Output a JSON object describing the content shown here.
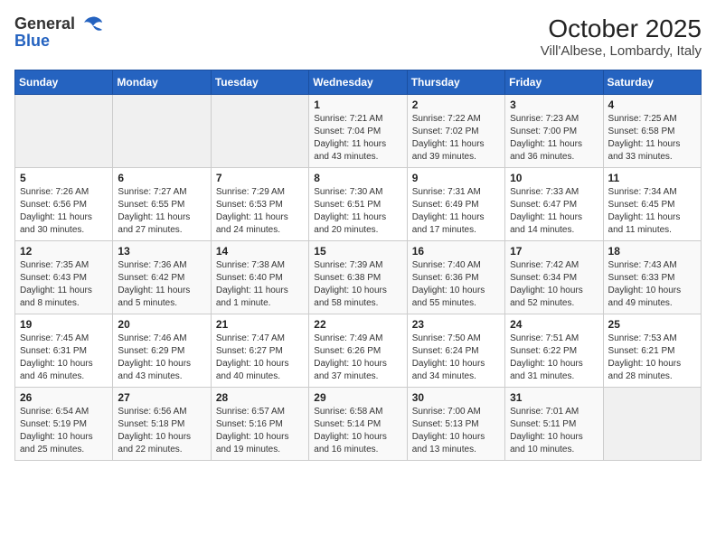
{
  "header": {
    "logo_general": "General",
    "logo_blue": "Blue",
    "month_title": "October 2025",
    "location": "Vill'Albese, Lombardy, Italy"
  },
  "weekdays": [
    "Sunday",
    "Monday",
    "Tuesday",
    "Wednesday",
    "Thursday",
    "Friday",
    "Saturday"
  ],
  "weeks": [
    [
      {
        "day": "",
        "info": ""
      },
      {
        "day": "",
        "info": ""
      },
      {
        "day": "",
        "info": ""
      },
      {
        "day": "1",
        "info": "Sunrise: 7:21 AM\nSunset: 7:04 PM\nDaylight: 11 hours and 43 minutes."
      },
      {
        "day": "2",
        "info": "Sunrise: 7:22 AM\nSunset: 7:02 PM\nDaylight: 11 hours and 39 minutes."
      },
      {
        "day": "3",
        "info": "Sunrise: 7:23 AM\nSunset: 7:00 PM\nDaylight: 11 hours and 36 minutes."
      },
      {
        "day": "4",
        "info": "Sunrise: 7:25 AM\nSunset: 6:58 PM\nDaylight: 11 hours and 33 minutes."
      }
    ],
    [
      {
        "day": "5",
        "info": "Sunrise: 7:26 AM\nSunset: 6:56 PM\nDaylight: 11 hours and 30 minutes."
      },
      {
        "day": "6",
        "info": "Sunrise: 7:27 AM\nSunset: 6:55 PM\nDaylight: 11 hours and 27 minutes."
      },
      {
        "day": "7",
        "info": "Sunrise: 7:29 AM\nSunset: 6:53 PM\nDaylight: 11 hours and 24 minutes."
      },
      {
        "day": "8",
        "info": "Sunrise: 7:30 AM\nSunset: 6:51 PM\nDaylight: 11 hours and 20 minutes."
      },
      {
        "day": "9",
        "info": "Sunrise: 7:31 AM\nSunset: 6:49 PM\nDaylight: 11 hours and 17 minutes."
      },
      {
        "day": "10",
        "info": "Sunrise: 7:33 AM\nSunset: 6:47 PM\nDaylight: 11 hours and 14 minutes."
      },
      {
        "day": "11",
        "info": "Sunrise: 7:34 AM\nSunset: 6:45 PM\nDaylight: 11 hours and 11 minutes."
      }
    ],
    [
      {
        "day": "12",
        "info": "Sunrise: 7:35 AM\nSunset: 6:43 PM\nDaylight: 11 hours and 8 minutes."
      },
      {
        "day": "13",
        "info": "Sunrise: 7:36 AM\nSunset: 6:42 PM\nDaylight: 11 hours and 5 minutes."
      },
      {
        "day": "14",
        "info": "Sunrise: 7:38 AM\nSunset: 6:40 PM\nDaylight: 11 hours and 1 minute."
      },
      {
        "day": "15",
        "info": "Sunrise: 7:39 AM\nSunset: 6:38 PM\nDaylight: 10 hours and 58 minutes."
      },
      {
        "day": "16",
        "info": "Sunrise: 7:40 AM\nSunset: 6:36 PM\nDaylight: 10 hours and 55 minutes."
      },
      {
        "day": "17",
        "info": "Sunrise: 7:42 AM\nSunset: 6:34 PM\nDaylight: 10 hours and 52 minutes."
      },
      {
        "day": "18",
        "info": "Sunrise: 7:43 AM\nSunset: 6:33 PM\nDaylight: 10 hours and 49 minutes."
      }
    ],
    [
      {
        "day": "19",
        "info": "Sunrise: 7:45 AM\nSunset: 6:31 PM\nDaylight: 10 hours and 46 minutes."
      },
      {
        "day": "20",
        "info": "Sunrise: 7:46 AM\nSunset: 6:29 PM\nDaylight: 10 hours and 43 minutes."
      },
      {
        "day": "21",
        "info": "Sunrise: 7:47 AM\nSunset: 6:27 PM\nDaylight: 10 hours and 40 minutes."
      },
      {
        "day": "22",
        "info": "Sunrise: 7:49 AM\nSunset: 6:26 PM\nDaylight: 10 hours and 37 minutes."
      },
      {
        "day": "23",
        "info": "Sunrise: 7:50 AM\nSunset: 6:24 PM\nDaylight: 10 hours and 34 minutes."
      },
      {
        "day": "24",
        "info": "Sunrise: 7:51 AM\nSunset: 6:22 PM\nDaylight: 10 hours and 31 minutes."
      },
      {
        "day": "25",
        "info": "Sunrise: 7:53 AM\nSunset: 6:21 PM\nDaylight: 10 hours and 28 minutes."
      }
    ],
    [
      {
        "day": "26",
        "info": "Sunrise: 6:54 AM\nSunset: 5:19 PM\nDaylight: 10 hours and 25 minutes."
      },
      {
        "day": "27",
        "info": "Sunrise: 6:56 AM\nSunset: 5:18 PM\nDaylight: 10 hours and 22 minutes."
      },
      {
        "day": "28",
        "info": "Sunrise: 6:57 AM\nSunset: 5:16 PM\nDaylight: 10 hours and 19 minutes."
      },
      {
        "day": "29",
        "info": "Sunrise: 6:58 AM\nSunset: 5:14 PM\nDaylight: 10 hours and 16 minutes."
      },
      {
        "day": "30",
        "info": "Sunrise: 7:00 AM\nSunset: 5:13 PM\nDaylight: 10 hours and 13 minutes."
      },
      {
        "day": "31",
        "info": "Sunrise: 7:01 AM\nSunset: 5:11 PM\nDaylight: 10 hours and 10 minutes."
      },
      {
        "day": "",
        "info": ""
      }
    ]
  ]
}
